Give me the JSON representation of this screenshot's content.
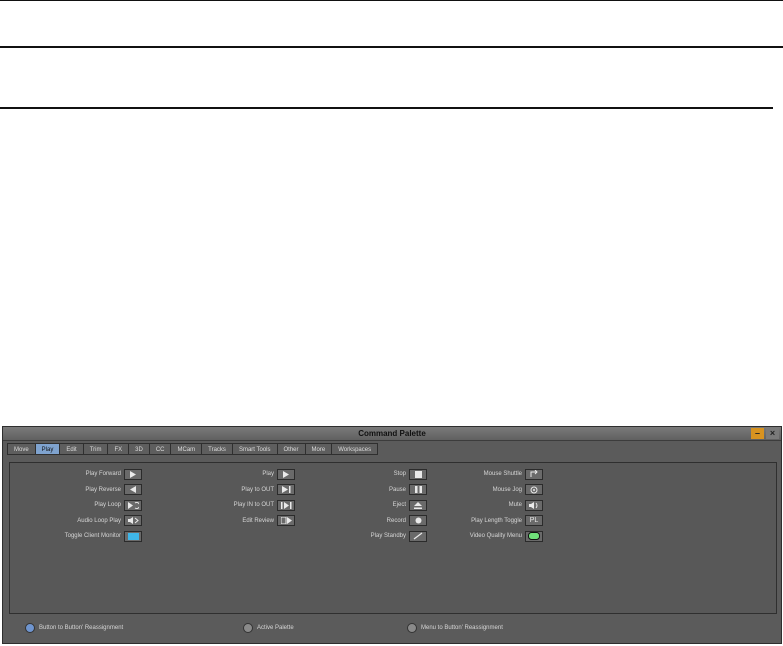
{
  "window": {
    "title": "Command Palette",
    "minimize_glyph": "–",
    "close_glyph": "×"
  },
  "tabs": [
    {
      "label": "Move",
      "active": false
    },
    {
      "label": "Play",
      "active": true
    },
    {
      "label": "Edit",
      "active": false
    },
    {
      "label": "Trim",
      "active": false
    },
    {
      "label": "FX",
      "active": false
    },
    {
      "label": "3D",
      "active": false
    },
    {
      "label": "CC",
      "active": false
    },
    {
      "label": "MCam",
      "active": false
    },
    {
      "label": "Tracks",
      "active": false
    },
    {
      "label": "Smart Tools",
      "active": false
    },
    {
      "label": "Other",
      "active": false
    },
    {
      "label": "More",
      "active": false
    },
    {
      "label": "Workspaces",
      "active": false
    }
  ],
  "commands": {
    "col1": [
      {
        "label": "Play Forward",
        "icon": "play-forward-icon"
      },
      {
        "label": "Play Reverse",
        "icon": "play-reverse-icon"
      },
      {
        "label": "Play Loop",
        "icon": "play-loop-icon"
      },
      {
        "label": "Audio Loop Play",
        "icon": "audio-loop-play-icon"
      },
      {
        "label": "Toggle Client Monitor",
        "icon": "client-monitor-icon"
      }
    ],
    "col2": [
      {
        "label": "Play",
        "icon": "play-icon"
      },
      {
        "label": "Play to OUT",
        "icon": "play-to-out-icon"
      },
      {
        "label": "Play IN to OUT",
        "icon": "play-in-to-out-icon"
      },
      {
        "label": "Edit Review",
        "icon": "edit-review-icon"
      }
    ],
    "col3": [
      {
        "label": "Stop",
        "icon": "stop-icon"
      },
      {
        "label": "Pause",
        "icon": "pause-icon"
      },
      {
        "label": "Eject",
        "icon": "eject-icon"
      },
      {
        "label": "Record",
        "icon": "record-icon"
      },
      {
        "label": "Play Standby",
        "icon": "play-standby-icon"
      }
    ],
    "col4": [
      {
        "label": "Mouse Shuttle",
        "icon": "mouse-shuttle-icon"
      },
      {
        "label": "Mouse Jog",
        "icon": "mouse-jog-icon"
      },
      {
        "label": "Mute",
        "icon": "mute-icon"
      },
      {
        "label": "Play Length Toggle",
        "icon": "play-length-toggle-icon",
        "text": "PL"
      },
      {
        "label": "Video Quality Menu",
        "icon": "video-quality-icon"
      }
    ]
  },
  "radio_options": [
    {
      "label": "Button to Button' Reassignment",
      "selected": true
    },
    {
      "label": "Active Palette",
      "selected": false
    },
    {
      "label": "Menu to Button' Reassignment",
      "selected": false
    }
  ],
  "colors": {
    "window_bg": "#5b5b5b",
    "active_tab": "#7fa3cf",
    "minimize_button": "#d89320",
    "client_monitor_accent": "#3fb6e8",
    "video_quality_accent": "#6fe07a"
  }
}
